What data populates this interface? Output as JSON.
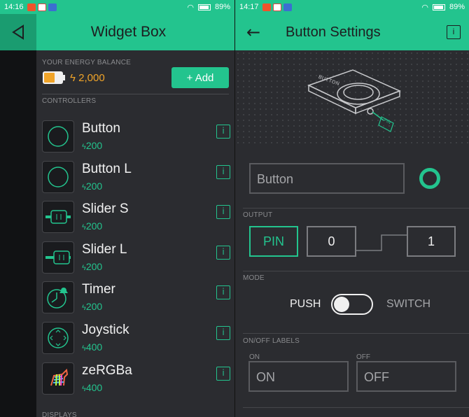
{
  "left": {
    "status": {
      "time": "14:16",
      "battery": "89%"
    },
    "appbar": {
      "title": "Widget Box"
    },
    "energy": {
      "label": "YOUR ENERGY BALANCE",
      "amount": "2,000",
      "add_label": "+ Add"
    },
    "controllers_label": "CONTROLLERS",
    "widgets": [
      {
        "name": "Button",
        "cost": "200",
        "icon": "button-icon"
      },
      {
        "name": "Button L",
        "cost": "200",
        "icon": "button-large-icon"
      },
      {
        "name": "Slider S",
        "cost": "200",
        "icon": "slider-small-icon"
      },
      {
        "name": "Slider L",
        "cost": "200",
        "icon": "slider-large-icon"
      },
      {
        "name": "Timer",
        "cost": "200",
        "icon": "timer-icon"
      },
      {
        "name": "Joystick",
        "cost": "400",
        "icon": "joystick-icon"
      },
      {
        "name": "zeRGBa",
        "cost": "400",
        "icon": "zergba-zebra-icon"
      }
    ],
    "info_glyph": "i",
    "displays_label": "DISPLAYS"
  },
  "right": {
    "status": {
      "time": "14:17",
      "battery": "89%"
    },
    "appbar": {
      "title": "Button Settings",
      "info_glyph": "i"
    },
    "illustration": {
      "device_label": "BUTTON",
      "pin_label": "PIN"
    },
    "name_field": "Button",
    "output": {
      "label": "OUTPUT",
      "pin": "PIN",
      "low": "0",
      "high": "1"
    },
    "mode": {
      "label": "MODE",
      "push": "PUSH",
      "switch": "SWITCH"
    },
    "labels": {
      "label": "ON/OFF LABELS",
      "on_label": "ON",
      "off_label": "OFF",
      "on_value": "ON",
      "off_value": "OFF"
    }
  },
  "colors": {
    "accent": "#23c48e",
    "energy": "#f0a429",
    "background": "#2b2c30"
  }
}
